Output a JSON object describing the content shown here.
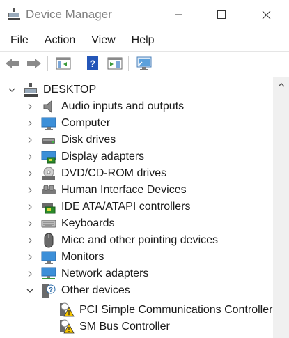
{
  "window": {
    "title": "Device Manager"
  },
  "menu": [
    "File",
    "Action",
    "View",
    "Help"
  ],
  "toolbar": {
    "buttons": [
      "back-icon",
      "forward-icon",
      "properties-console-icon",
      "help-icon",
      "show-hide-pane-icon",
      "scan-hardware-icon"
    ]
  },
  "tree": {
    "root": "DESKTOP",
    "categories": [
      "Audio inputs and outputs",
      "Computer",
      "Disk drives",
      "Display adapters",
      "DVD/CD-ROM drives",
      "Human Interface Devices",
      "IDE ATA/ATAPI controllers",
      "Keyboards",
      "Mice and other pointing devices",
      "Monitors",
      "Network adapters",
      "Other devices"
    ],
    "other_devices_children": [
      "PCI Simple Communications Controller",
      "SM Bus Controller"
    ]
  },
  "colors": {
    "accent": "#0078d7",
    "title_text": "#808080",
    "warning": "#f5c400"
  }
}
